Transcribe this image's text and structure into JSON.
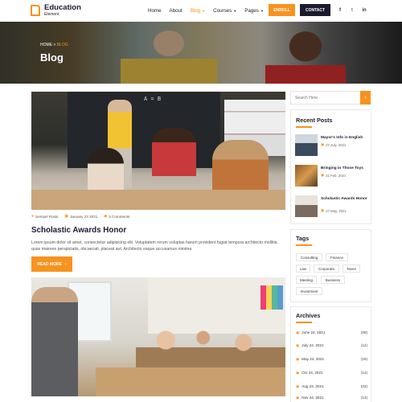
{
  "header": {
    "logo_title": "Education",
    "logo_sub": "Element",
    "nav": [
      {
        "label": "Home"
      },
      {
        "label": "About"
      },
      {
        "label": "Blog",
        "active": true,
        "caret": true
      },
      {
        "label": "Courses",
        "caret": true
      },
      {
        "label": "Pages",
        "caret": true
      }
    ],
    "enroll_label": "ENROLL",
    "contact_label": "CONTACT",
    "social": [
      "f",
      "t",
      "in"
    ]
  },
  "hero": {
    "crumb_home": "HOME",
    "crumb_sep": ">",
    "crumb_current": "BLOG",
    "title": "Blog"
  },
  "post": {
    "meta_author": "Sempel Posts",
    "meta_date": "January 23 2021",
    "meta_comments": "3 Comments",
    "title": "Scholastic Awards Honor",
    "excerpt": "Lorem ipsum dolor sit amet, consectetur adipisicing elit. Voluptatem rerum voluptas harum provident fugiat tempora architecto mollitia quas maiores perspiciatis, obcaecati, placeat aut. Architecto eaque accusamus minima",
    "read_more": "READ MORE",
    "board_text": "A = B"
  },
  "sidebar": {
    "search_placeholder": "Search Here",
    "recent_title": "Recent Posts",
    "recent": [
      {
        "title": "Mayor's Info in English",
        "date": "27 July, 2021"
      },
      {
        "title": "Bringing in Those Toys",
        "date": "21 Feb, 2021"
      },
      {
        "title": "Scholastic Awards Honor",
        "date": "27 May, 2021"
      }
    ],
    "tags_title": "Tags",
    "tags": [
      "Consulting",
      "Finance",
      "Law",
      "Corporate",
      "Taxes",
      "Meeting",
      "Business",
      "Investment"
    ],
    "archives_title": "Archives",
    "archives": [
      {
        "label": "June 24, 2021",
        "count": "(09)"
      },
      {
        "label": "July 24, 2021",
        "count": "(12)"
      },
      {
        "label": "May 24, 2021",
        "count": "(19)"
      },
      {
        "label": "Oct 24, 2021",
        "count": "(14)"
      },
      {
        "label": "Aug 24, 2021",
        "count": "(03)"
      },
      {
        "label": "Nov 24, 2021",
        "count": "(13)"
      }
    ]
  },
  "colors": {
    "accent": "#f7931e",
    "dark": "#1b1b2f"
  }
}
